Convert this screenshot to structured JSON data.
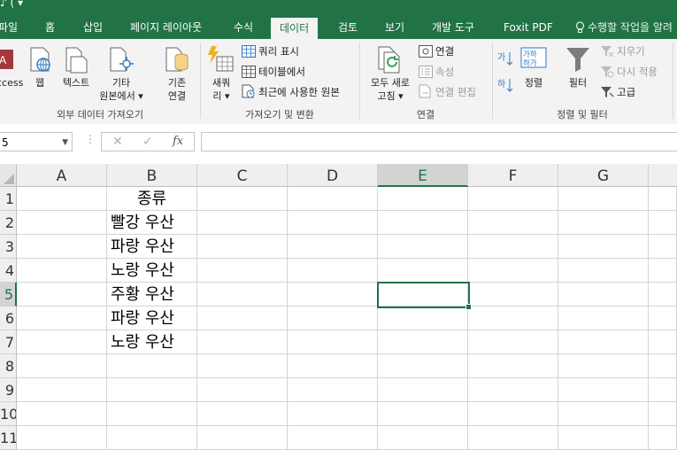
{
  "titlebar": {
    "qat_glyphs": "♪ ( ▾"
  },
  "tabs": [
    {
      "label": "파일",
      "active": false
    },
    {
      "label": "홈",
      "active": false
    },
    {
      "label": "삽입",
      "active": false
    },
    {
      "label": "페이지 레이아웃",
      "active": false
    },
    {
      "label": "수식",
      "active": false
    },
    {
      "label": "데이터",
      "active": true
    },
    {
      "label": "검토",
      "active": false
    },
    {
      "label": "보기",
      "active": false
    },
    {
      "label": "개발 도구",
      "active": false
    },
    {
      "label": "Foxit PDF",
      "active": false
    }
  ],
  "tell_me": "수행할 작업을 알려",
  "ribbon": {
    "external": {
      "group_label": "외부 데이터 가져오기",
      "access": "ccess",
      "web": "웹",
      "text": "텍스트",
      "other_line1": "기타",
      "other_line2": "원본에서 ▾",
      "existing_line1": "기존",
      "existing_line2": "연결"
    },
    "get_transform": {
      "group_label": "가져오기 및 변환",
      "new_query_line1": "새쿼",
      "new_query_line2": "리 ▾",
      "show_queries": "쿼리 표시",
      "from_table": "테이블에서",
      "recent_sources": "최근에 사용한 원본"
    },
    "connections": {
      "group_label": "연결",
      "refresh_line1": "모두 새로",
      "refresh_line2": "고침 ▾",
      "connections": "연결",
      "properties": "속성",
      "edit_links": "연결 편집"
    },
    "sort_filter": {
      "group_label": "정렬 및 필터",
      "sort": "정렬",
      "filter": "필터",
      "clear": "지우기",
      "reapply": "다시 적용",
      "advanced": "고급"
    }
  },
  "formula_bar": {
    "name_box": "5",
    "cancel": "✕",
    "enter": "✓",
    "fx": "fx",
    "content": ""
  },
  "columns": [
    "A",
    "B",
    "C",
    "D",
    "E",
    "F",
    "G"
  ],
  "selected_column": "E",
  "rows": [
    "1",
    "2",
    "3",
    "4",
    "5",
    "6",
    "7",
    "8",
    "9",
    "10",
    "11"
  ],
  "selected_row": "5",
  "cells_b": [
    "종류",
    "빨강 우산",
    "파랑 우산",
    "노랑 우산",
    "주황 우산",
    "파랑 우산",
    "노랑 우산"
  ],
  "colors": {
    "accent": "#217346",
    "ribbon_bg": "#f3f3f3"
  }
}
